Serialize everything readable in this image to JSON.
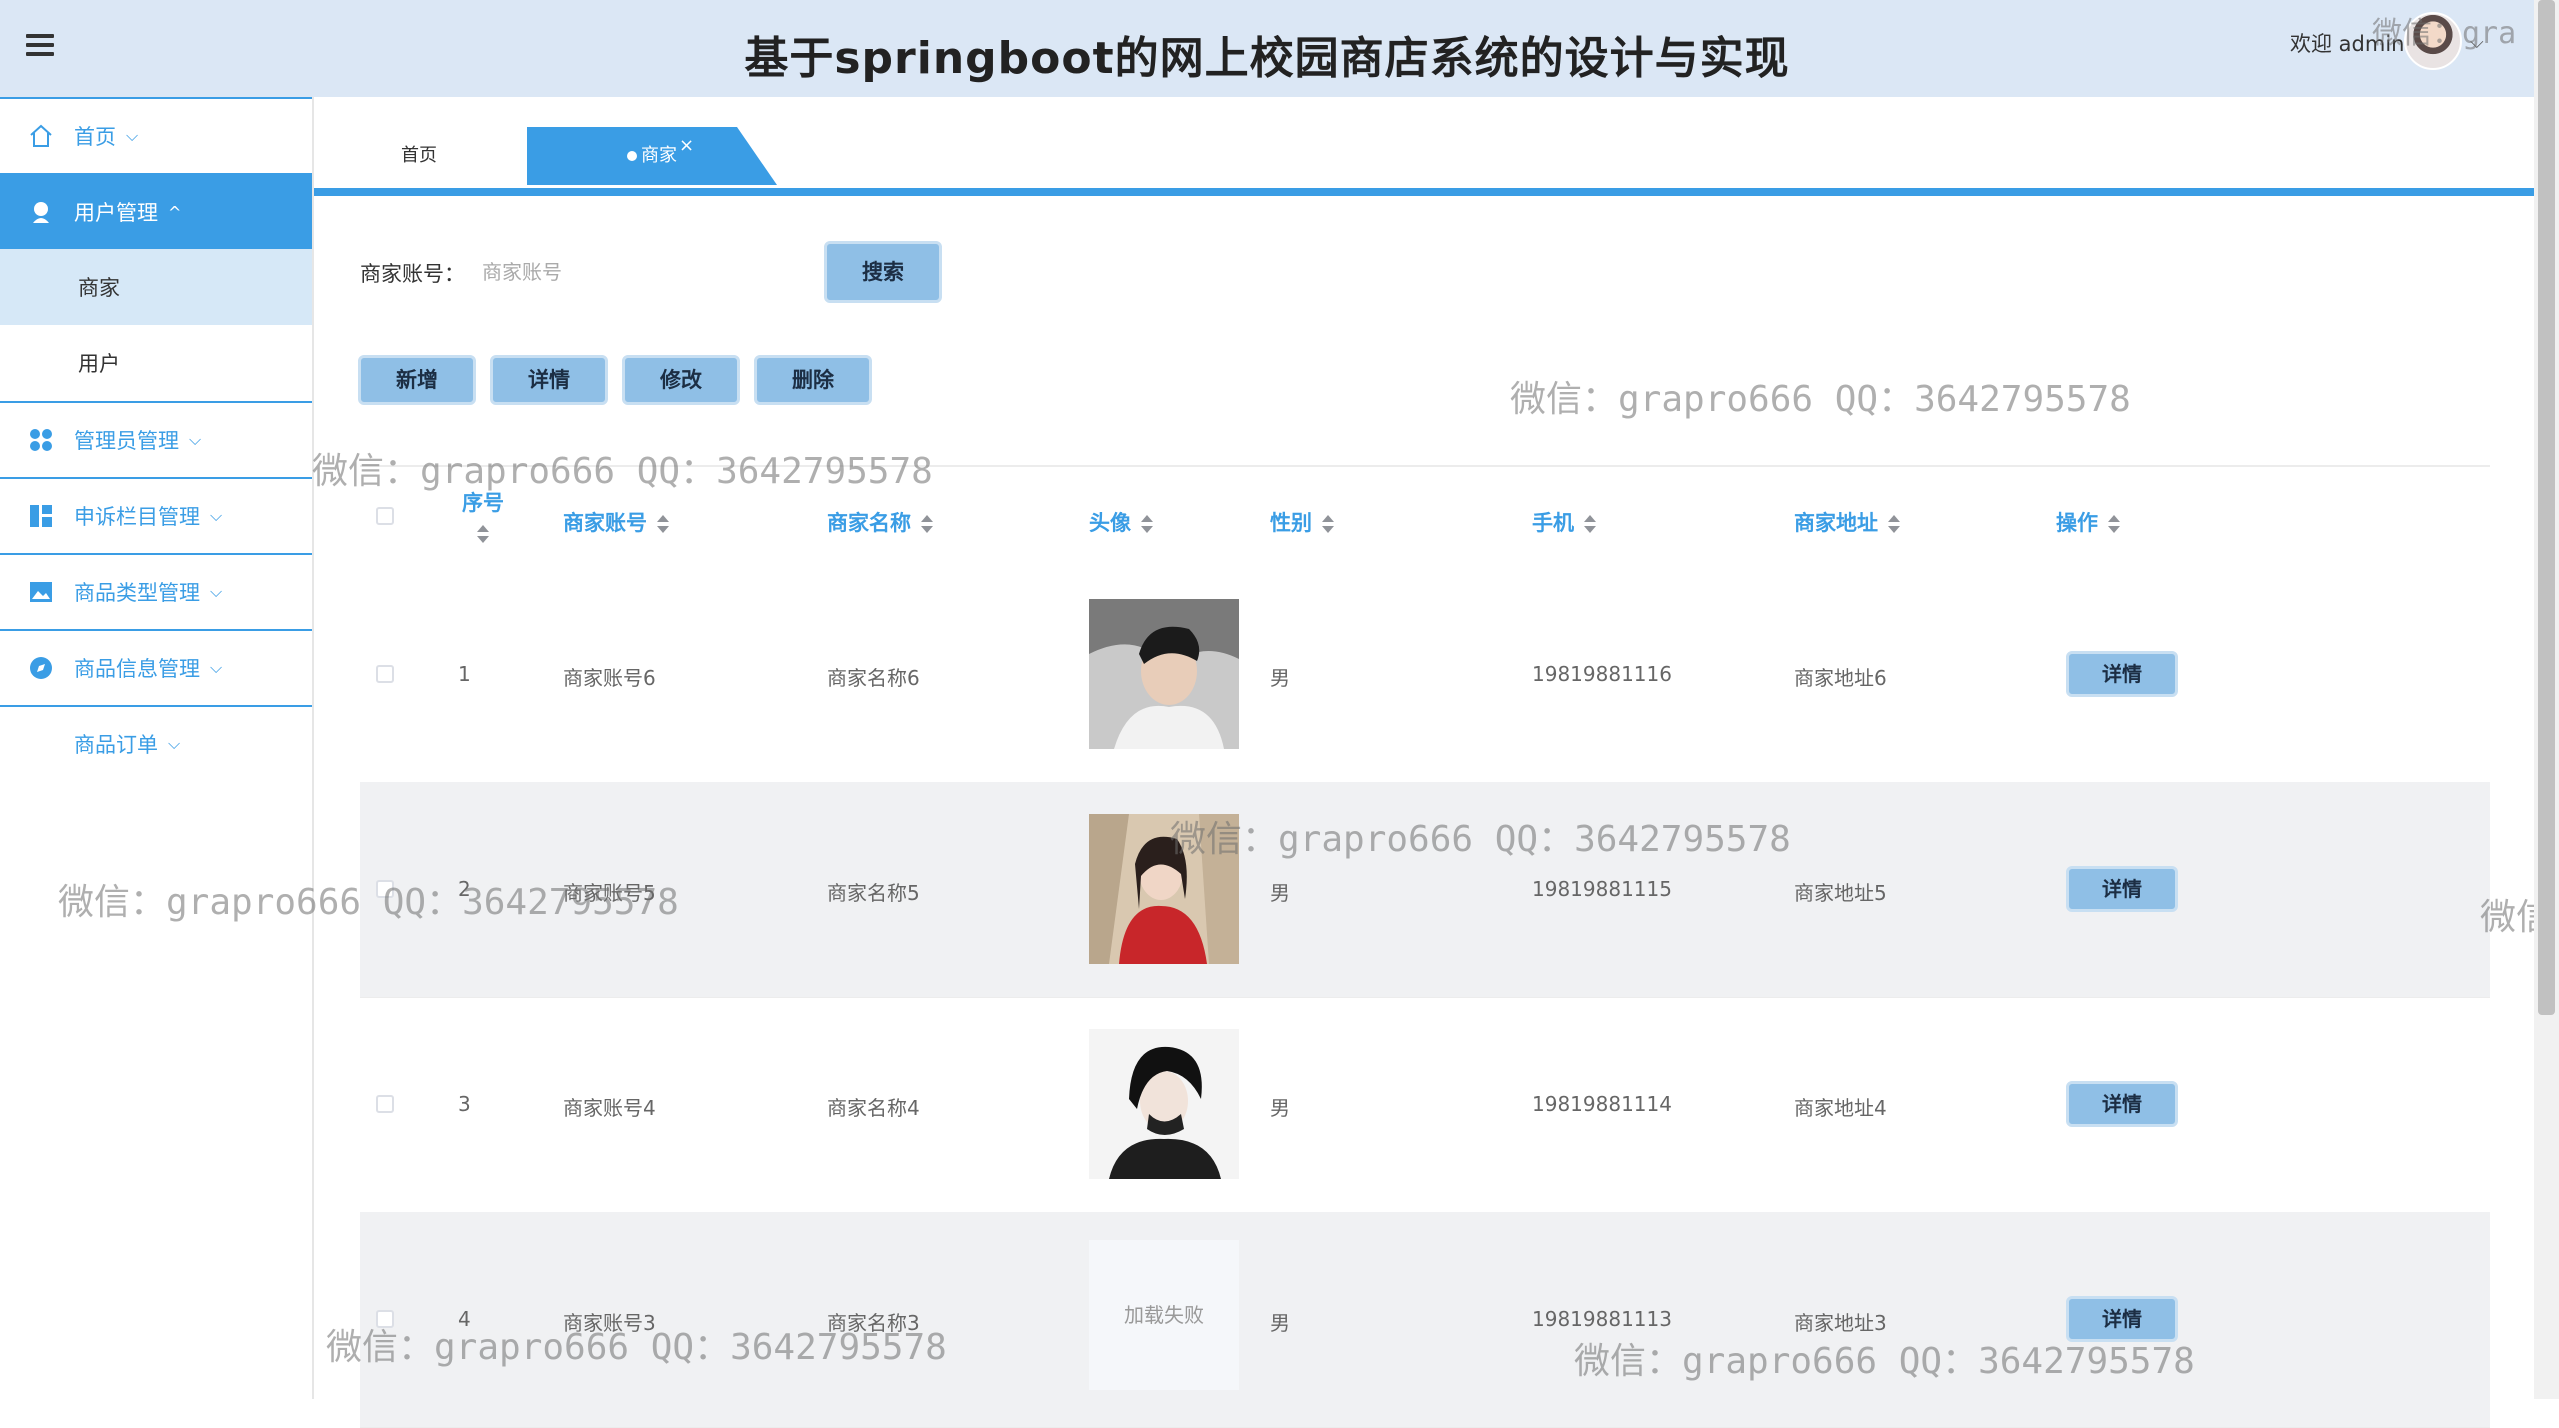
{
  "header": {
    "title": "基于springboot的网上校园商店系统的设计与实现",
    "welcome": "欢迎 admin",
    "caret": "⌵"
  },
  "sidebar": {
    "items": [
      {
        "label": "首页",
        "icon": "home-icon",
        "caret": "⌵"
      },
      {
        "label": "用户管理",
        "icon": "user-icon",
        "caret": "^"
      },
      {
        "label": "管理员管理",
        "icon": "grid-icon",
        "caret": "⌵"
      },
      {
        "label": "申诉栏目管理",
        "icon": "layout-icon",
        "caret": "⌵"
      },
      {
        "label": "商品类型管理",
        "icon": "picture-icon",
        "caret": "⌵"
      },
      {
        "label": "商品信息管理",
        "icon": "compass-icon",
        "caret": "⌵"
      },
      {
        "label": "商品订单",
        "icon": "",
        "caret": "⌵"
      }
    ],
    "submenu": [
      {
        "label": "商家"
      },
      {
        "label": "用户"
      }
    ]
  },
  "tabs": {
    "home": "首页",
    "active": "商家",
    "close": "×"
  },
  "search": {
    "label": "商家账号：",
    "placeholder": "商家账号",
    "value": "",
    "button": "搜索"
  },
  "actions": {
    "add": "新增",
    "detail": "详情",
    "edit": "修改",
    "delete": "删除"
  },
  "table": {
    "columns": [
      "序号",
      "商家账号",
      "商家名称",
      "头像",
      "性别",
      "手机",
      "商家地址",
      "操作"
    ],
    "rows": [
      {
        "index": "1",
        "account": "商家账号6",
        "name": "商家名称6",
        "avatar": "image",
        "gender": "男",
        "phone": "19819881116",
        "address": "商家地址6",
        "action": "详情"
      },
      {
        "index": "2",
        "account": "商家账号5",
        "name": "商家名称5",
        "avatar": "image",
        "gender": "男",
        "phone": "19819881115",
        "address": "商家地址5",
        "action": "详情"
      },
      {
        "index": "3",
        "account": "商家账号4",
        "name": "商家名称4",
        "avatar": "image",
        "gender": "男",
        "phone": "19819881114",
        "address": "商家地址4",
        "action": "详情"
      },
      {
        "index": "4",
        "account": "商家账号3",
        "name": "商家名称3",
        "avatar": "加载失败",
        "gender": "男",
        "phone": "19819881113",
        "address": "商家地址3",
        "action": "详情"
      }
    ]
  },
  "watermark": {
    "text": "微信：grapro666 QQ：3642795578",
    "fragment_left": "微信",
    "fragment_top": "微信：gra"
  },
  "colors": {
    "accent": "#3a9de5",
    "header_bg": "#dbe7f5",
    "button_bg": "#8fbfe6",
    "row_alt": "#f0f1f3"
  }
}
